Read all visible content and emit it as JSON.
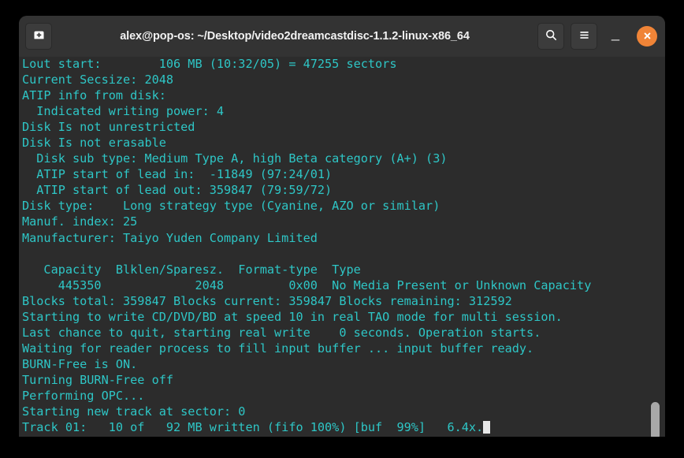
{
  "window": {
    "title": "alex@pop-os: ~/Desktop/video2dreamcastdisc-1.1.2-linux-x86_64",
    "new_tab_icon": "terminal-plus-icon",
    "search_icon": "search-icon",
    "menu_icon": "hamburger-menu-icon",
    "minimize_label": "_",
    "close_label": "×",
    "colors": {
      "titlebar_bg": "#333333",
      "terminal_bg": "#2c2c2c",
      "text": "#2ec6c6",
      "close_button": "#f08437",
      "cursor": "#e8e8e8",
      "scrollbar_thumb": "#a8a8a8"
    }
  },
  "terminal": {
    "lines": [
      "Lout start:        106 MB (10:32/05) = 47255 sectors",
      "Current Secsize: 2048",
      "ATIP info from disk:",
      "  Indicated writing power: 4",
      "Disk Is not unrestricted",
      "Disk Is not erasable",
      "  Disk sub type: Medium Type A, high Beta category (A+) (3)",
      "  ATIP start of lead in:  -11849 (97:24/01)",
      "  ATIP start of lead out: 359847 (79:59/72)",
      "Disk type:    Long strategy type (Cyanine, AZO or similar)",
      "Manuf. index: 25",
      "Manufacturer: Taiyo Yuden Company Limited",
      "",
      "   Capacity  Blklen/Sparesz.  Format-type  Type",
      "     445350             2048         0x00  No Media Present or Unknown Capacity",
      "Blocks total: 359847 Blocks current: 359847 Blocks remaining: 312592",
      "Starting to write CD/DVD/BD at speed 10 in real TAO mode for multi session.",
      "Last chance to quit, starting real write    0 seconds. Operation starts.",
      "Waiting for reader process to fill input buffer ... input buffer ready.",
      "BURN-Free is ON.",
      "Turning BURN-Free off",
      "Performing OPC...",
      "Starting new track at sector: 0"
    ],
    "last_line": "Track 01:   10 of   92 MB written (fifo 100%) [buf  99%]   6.4x.",
    "cursor": "block-cursor"
  }
}
